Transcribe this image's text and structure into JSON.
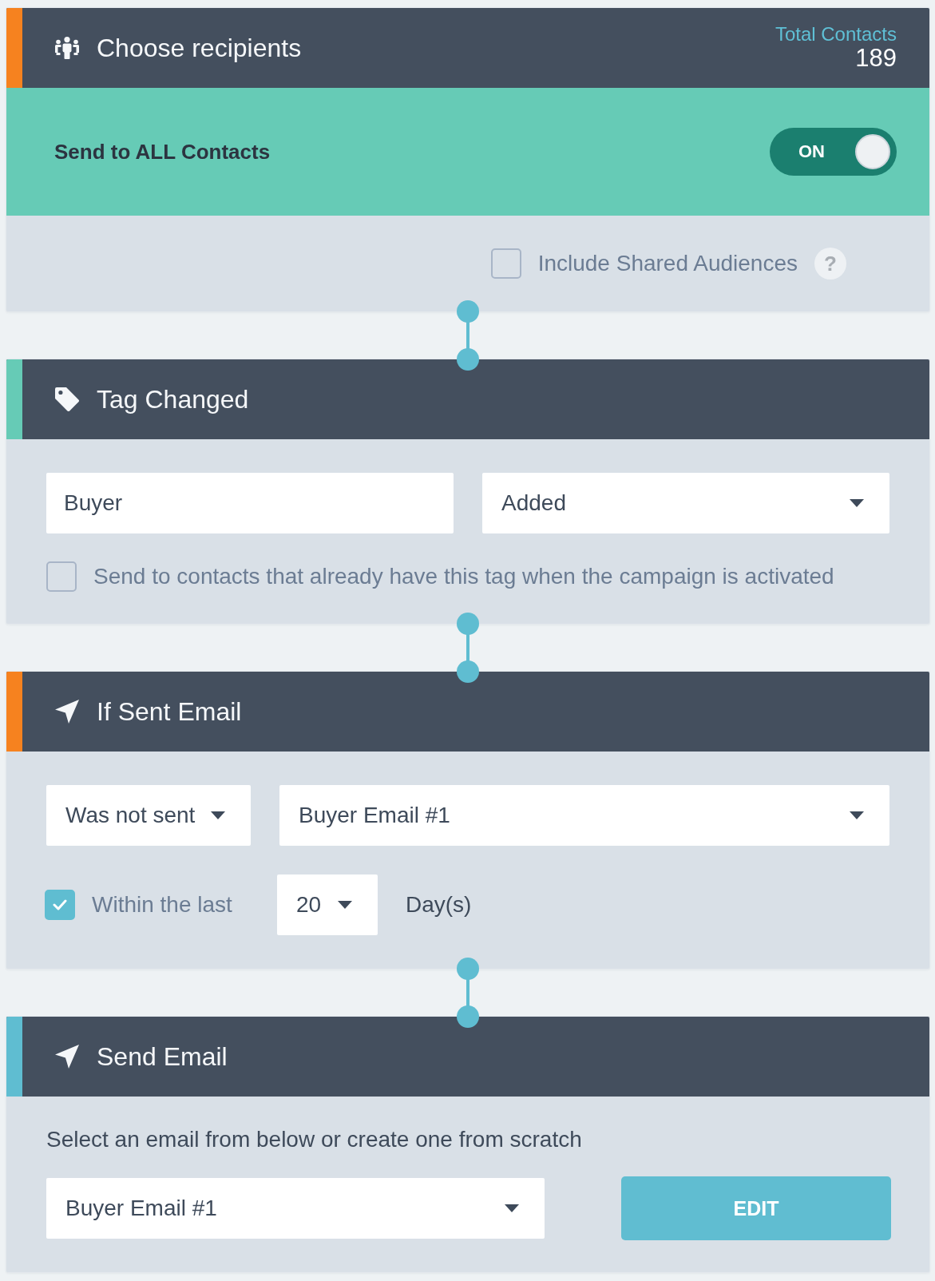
{
  "steps": [
    {
      "kind": "recipients",
      "color": "#f6821f",
      "title": "Choose recipients",
      "total": {
        "label": "Total Contacts",
        "value": "189"
      },
      "send_all": {
        "label": "Send to ALL Contacts",
        "toggle": {
          "label": "ON",
          "on": true
        }
      },
      "include_shared": {
        "label": "Include Shared Audiences",
        "checked": false,
        "help": "?"
      }
    },
    {
      "kind": "tag_changed",
      "color": "#66cbb6",
      "title": "Tag Changed",
      "tag_field": {
        "value": "Buyer"
      },
      "action_select": {
        "value": "Added"
      },
      "existing_option": {
        "label": "Send to contacts that already have this tag when the campaign is activated",
        "checked": false
      }
    },
    {
      "kind": "if_sent",
      "color": "#f6821f",
      "title": "If Sent Email",
      "condition_select": {
        "value": "Was not sent"
      },
      "email_select": {
        "value": "Buyer Email #1"
      },
      "within": {
        "label": "Within the last",
        "checked": true
      },
      "days_select": {
        "value": "20"
      },
      "unit": "Day(s)"
    },
    {
      "kind": "send_email",
      "color": "#5fbdd1",
      "title": "Send Email",
      "instruction": "Select an email from below or create one from scratch",
      "email_select": {
        "value": "Buyer Email #1"
      },
      "edit_button": "EDIT"
    }
  ]
}
